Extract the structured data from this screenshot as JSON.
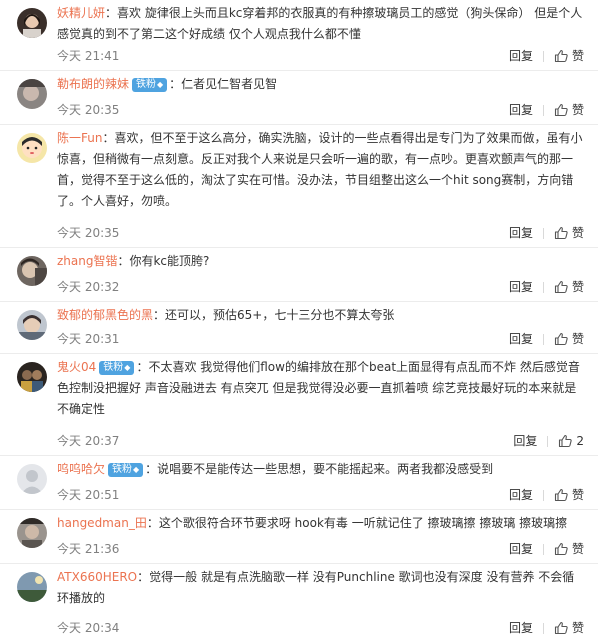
{
  "comments": [
    {
      "user": "妖精儿妍",
      "badge": "",
      "text": "：喜欢 旋律很上头而且kc穿着邦的衣服真的有种擦玻璃员工的感觉（狗头保命） 但是个人感觉真的到不了第二这个好成绩 仅个人观点我什么都不懂",
      "time": "今天 21:41",
      "reply": "回复",
      "like": "赞",
      "like_count": ""
    },
    {
      "user": "勒布朗的辣妹",
      "badge": "铁粉",
      "text": "：仁者见仁智者见智",
      "time": "今天 20:35",
      "reply": "回复",
      "like": "赞",
      "like_count": ""
    },
    {
      "user": "陈一Fun",
      "badge": "",
      "text": "：喜欢，但不至于这么高分，确实洗脑，设计的一些点看得出是专门为了效果而做，虽有小惊喜，但稍微有一点刻意。反正对我个人来说是只会听一遍的歌，有一点吵。更喜欢颤声气的那一首，觉得不至于这么低的，淘汰了实在可惜。没办法，节目组整出这么一个hit song赛制，方向错了。个人喜好，勿喷。",
      "time": "今天 20:35",
      "reply": "回复",
      "like": "赞",
      "like_count": ""
    },
    {
      "user": "zhang智锴",
      "badge": "",
      "text": "：你有kc能顶胯?",
      "time": "今天 20:32",
      "reply": "回复",
      "like": "赞",
      "like_count": ""
    },
    {
      "user": "致郁的郁黑色的黑",
      "badge": "",
      "text": "：还可以，预估65+，七十三分也不算太夸张",
      "time": "今天 20:31",
      "reply": "回复",
      "like": "赞",
      "like_count": ""
    },
    {
      "user": "鬼火04",
      "badge": "铁粉",
      "text": "：不太喜欢 我觉得他们flow的编排放在那个beat上面显得有点乱而不炸 然后感觉音色控制没把握好 声音没融进去 有点突兀 但是我觉得没必要一直抓着喷 综艺竞技最好玩的本来就是不确定性",
      "time": "今天 20:37",
      "reply": "回复",
      "like": "",
      "like_count": "2"
    },
    {
      "user": "呜呜哈欠",
      "badge": "铁粉",
      "text": "：说唱要不是能传达一些思想，要不能摇起来。两者我都没感受到",
      "time": "今天 20:51",
      "reply": "回复",
      "like": "赞",
      "like_count": ""
    },
    {
      "user": "hangedman_田",
      "badge": "",
      "text": "：这个歌很符合环节要求呀 hook有毒 一听就记住了 擦玻璃擦 擦玻璃 擦玻璃擦",
      "time": "今天 21:36",
      "reply": "回复",
      "like": "赞",
      "like_count": ""
    },
    {
      "user": "ATX660HERO",
      "badge": "",
      "text": "：觉得一般 就是有点洗脑歌一样 没有Punchline 歌词也没有深度 没有营养 不会循环播放的",
      "time": "今天 20:34",
      "reply": "回复",
      "like": "赞",
      "like_count": ""
    }
  ],
  "colors": {
    "username": "#eb7350",
    "badge": "#4fa3e0",
    "time": "#808080",
    "divider": "#ececec"
  }
}
